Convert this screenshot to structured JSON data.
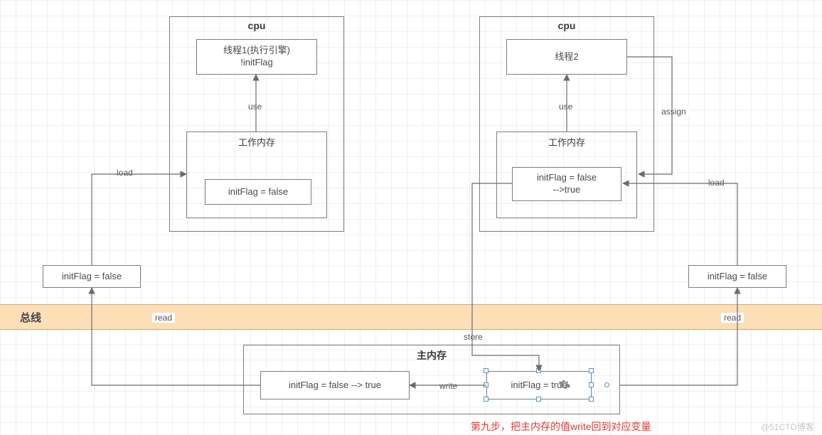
{
  "cpu1": {
    "title": "cpu",
    "thread_box": "线程1(执行引擎)\n!initFlag",
    "workmem_title": "工作内存",
    "workmem_value": "initFlag = false"
  },
  "cpu2": {
    "title": "cpu",
    "thread_box": "线程2",
    "workmem_title": "工作内存",
    "workmem_value": "initFlag = false\n-->true"
  },
  "left_buffer": "initFlag = false",
  "right_buffer": "initFlag = false",
  "bus_label": "总线",
  "mainmem": {
    "title": "主内存",
    "var_box": "initFlag = false --> true",
    "write_box": "initFlag = true"
  },
  "labels": {
    "use1": "use",
    "use2": "use",
    "assign": "assign",
    "load1": "load",
    "load2": "load",
    "read1": "read",
    "read2": "read",
    "store": "store",
    "write": "write"
  },
  "caption": "第九步，把主内存的值write回到对应变量",
  "watermark": "@51CTO博客"
}
